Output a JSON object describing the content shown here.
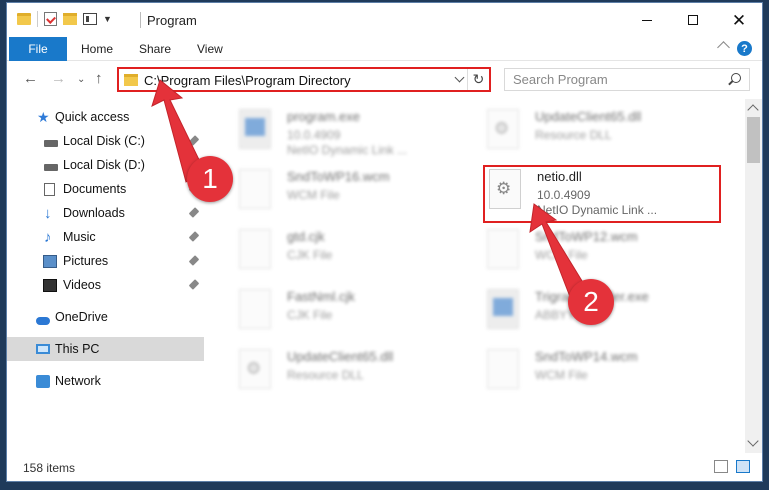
{
  "window": {
    "title": "Program"
  },
  "ribbon": {
    "tabs": [
      "File",
      "Home",
      "Share",
      "View"
    ],
    "help": "?"
  },
  "address": {
    "path": "C:\\Program Files\\Program Directory",
    "refresh": "↻"
  },
  "search": {
    "placeholder": "Search Program"
  },
  "sidebar": {
    "items": [
      {
        "label": "Quick access",
        "icon": "star-icon"
      },
      {
        "label": "Local Disk (C:)",
        "icon": "disk-icon"
      },
      {
        "label": "Local Disk (D:)",
        "icon": "disk-icon"
      },
      {
        "label": "Documents",
        "icon": "documents-icon"
      },
      {
        "label": "Downloads",
        "icon": "download-icon"
      },
      {
        "label": "Music",
        "icon": "music-icon"
      },
      {
        "label": "Pictures",
        "icon": "pictures-icon"
      },
      {
        "label": "Videos",
        "icon": "videos-icon"
      },
      {
        "label": "OneDrive",
        "icon": "cloud-icon"
      },
      {
        "label": "This PC",
        "icon": "computer-icon"
      },
      {
        "label": "Network",
        "icon": "network-icon"
      }
    ]
  },
  "files": [
    {
      "name": "program.exe",
      "line2": "10.0.4909",
      "line3": "NetIO Dynamic Link ..."
    },
    {
      "name": "UpdateClient65.dll",
      "line2": "Resource DLL",
      "line3": ""
    },
    {
      "name": "SndToWP16.wcm",
      "line2": "WCM File",
      "line3": ""
    },
    {
      "name": "netio.dll",
      "line2": "10.0.4909",
      "line3": "NetIO Dynamic Link ..."
    },
    {
      "name": "gtd.cjk",
      "line2": "CJK File",
      "line3": ""
    },
    {
      "name": "SndToWP12.wcm",
      "line2": "WCM File",
      "line3": ""
    },
    {
      "name": "FastNml.cjk",
      "line2": "CJK File",
      "line3": ""
    },
    {
      "name": "TrigramInstaller.exe",
      "line2": "ABBYY ...",
      "line3": ""
    },
    {
      "name": "UpdateClient65.dll",
      "line2": "Resource DLL",
      "line3": ""
    },
    {
      "name": "SndToWP14.wcm",
      "line2": "WCM File",
      "line3": ""
    }
  ],
  "status": {
    "count": "158 items"
  },
  "annotations": {
    "step1": "1",
    "step2": "2"
  },
  "colors": {
    "accent": "#1979ca",
    "highlight": "#e02020",
    "badge": "#e4323a"
  }
}
